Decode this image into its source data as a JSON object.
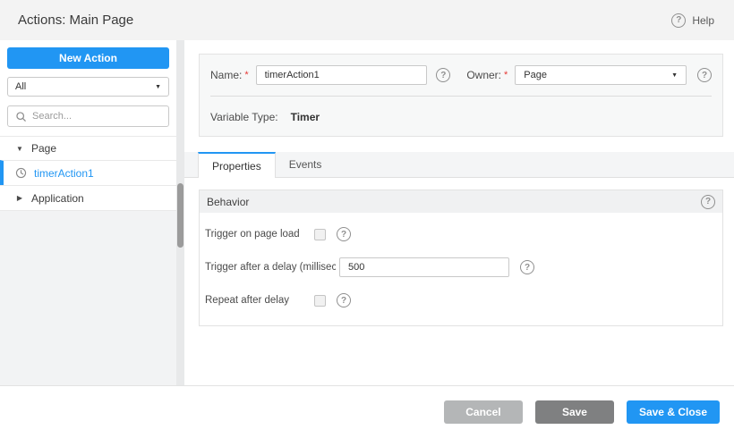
{
  "header": {
    "title": "Actions: Main Page",
    "help_label": "Help"
  },
  "icons": {
    "help_glyph": "?",
    "caret_down": "▼",
    "tree_expanded": "▼",
    "tree_collapsed": "▶"
  },
  "colors": {
    "accent_blue": "#2196f3",
    "cancel_gray": "#b4b6b7",
    "save_gray": "#7f8081",
    "required_red": "#e53935"
  },
  "sidebar": {
    "new_action_label": "New Action",
    "filter_value": "All",
    "search_placeholder": "Search...",
    "tree": [
      {
        "label": "Page",
        "expanded": true
      },
      {
        "label": "timerAction1",
        "selected": true
      },
      {
        "label": "Application",
        "expanded": false
      }
    ]
  },
  "form": {
    "name_label": "Name:",
    "required_marker": "*",
    "name_value": "timerAction1",
    "owner_label": "Owner:",
    "owner_value": "Page",
    "variable_type_label": "Variable Type:",
    "variable_type_value": "Timer"
  },
  "tabs": [
    {
      "label": "Properties",
      "active": true
    },
    {
      "label": "Events",
      "active": false
    }
  ],
  "behavior": {
    "section_title": "Behavior",
    "rows": [
      {
        "label": "Trigger on page load",
        "control": "checkbox",
        "checked": false
      },
      {
        "label": "Trigger after a delay (millisec…",
        "control": "input",
        "value": "500"
      },
      {
        "label": "Repeat after delay",
        "control": "checkbox",
        "checked": false
      }
    ]
  },
  "footer": {
    "cancel_label": "Cancel",
    "save_label": "Save",
    "save_close_label": "Save & Close"
  }
}
